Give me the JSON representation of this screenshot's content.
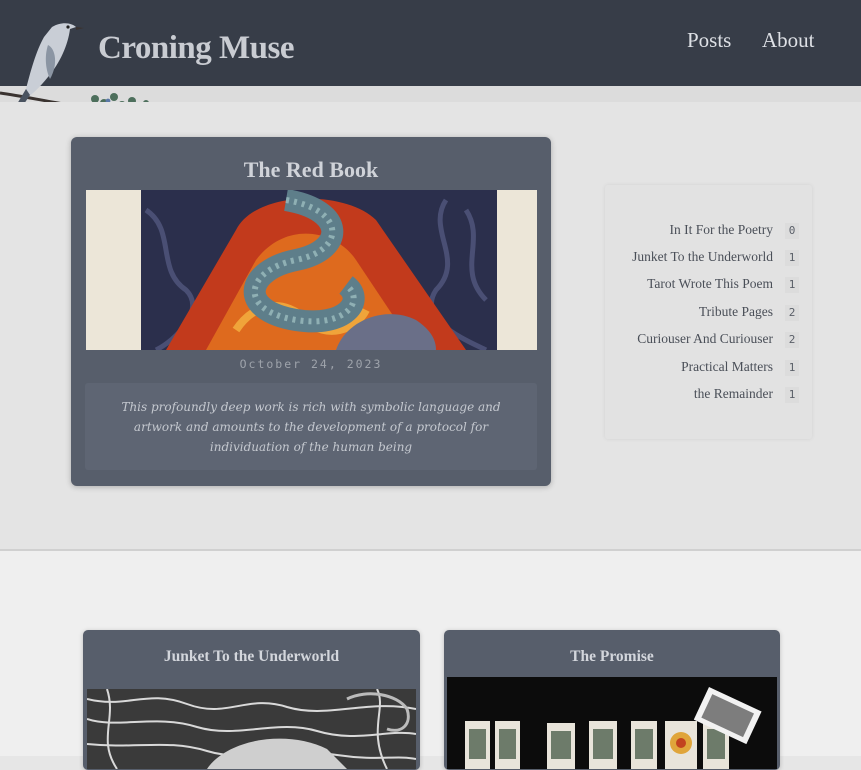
{
  "site": {
    "title": "Croning Muse",
    "nav": [
      {
        "label": "Posts"
      },
      {
        "label": "About"
      }
    ]
  },
  "featured": {
    "title": "The Red Book",
    "date": "October 24, 2023",
    "excerpt": "This profoundly deep work is rich with symbolic language and artwork and amounts to the development of a protocol for individuation of the human being"
  },
  "tags": [
    {
      "name": "In It For the Poetry",
      "count": "0"
    },
    {
      "name": "Junket To the Underworld",
      "count": "1"
    },
    {
      "name": "Tarot Wrote This Poem",
      "count": "1"
    },
    {
      "name": "Tribute Pages",
      "count": "2"
    },
    {
      "name": "Curiouser And Curiouser",
      "count": "2"
    },
    {
      "name": "Practical Matters",
      "count": "1"
    },
    {
      "name": "the Remainder",
      "count": "1"
    }
  ],
  "posts": [
    {
      "title": "Junket To the Underworld"
    },
    {
      "title": "The Promise"
    }
  ],
  "colors": {
    "header": "#373d48",
    "card": "#575e6b",
    "page": "#e6e6e6"
  }
}
